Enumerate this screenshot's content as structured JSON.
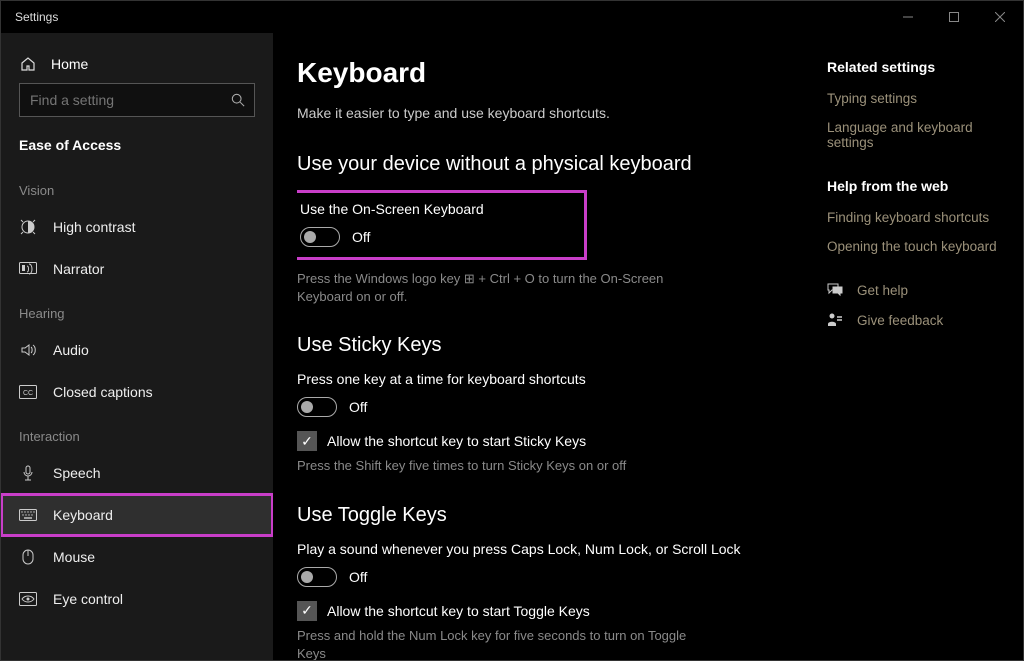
{
  "window": {
    "title": "Settings"
  },
  "sidebar": {
    "home": "Home",
    "search_placeholder": "Find a setting",
    "category": "Ease of Access",
    "groups": [
      {
        "label": "Vision",
        "items": [
          "High contrast",
          "Narrator"
        ]
      },
      {
        "label": "Hearing",
        "items": [
          "Audio",
          "Closed captions"
        ]
      },
      {
        "label": "Interaction",
        "items": [
          "Speech",
          "Keyboard",
          "Mouse",
          "Eye control"
        ]
      }
    ]
  },
  "page": {
    "title": "Keyboard",
    "subtitle": "Make it easier to type and use keyboard shortcuts.",
    "s1": {
      "heading": "Use your device without a physical keyboard",
      "label": "Use the On-Screen Keyboard",
      "state": "Off",
      "hint": "Press the Windows logo key ⊞ + Ctrl + O to turn the On-Screen Keyboard on or off."
    },
    "s2": {
      "heading": "Use Sticky Keys",
      "label": "Press one key at a time for keyboard shortcuts",
      "state": "Off",
      "check": "Allow the shortcut key to start Sticky Keys",
      "hint": "Press the Shift key five times to turn Sticky Keys on or off"
    },
    "s3": {
      "heading": "Use Toggle Keys",
      "label": "Play a sound whenever you press Caps Lock, Num Lock, or Scroll Lock",
      "state": "Off",
      "check": "Allow the shortcut key to start Toggle Keys",
      "hint": "Press and hold the Num Lock key for five seconds to turn on Toggle Keys"
    }
  },
  "right": {
    "related_h": "Related settings",
    "related": [
      "Typing settings",
      "Language and keyboard settings"
    ],
    "help_h": "Help from the web",
    "help": [
      "Finding keyboard shortcuts",
      "Opening the touch keyboard"
    ],
    "gethelp": "Get help",
    "feedback": "Give feedback"
  }
}
